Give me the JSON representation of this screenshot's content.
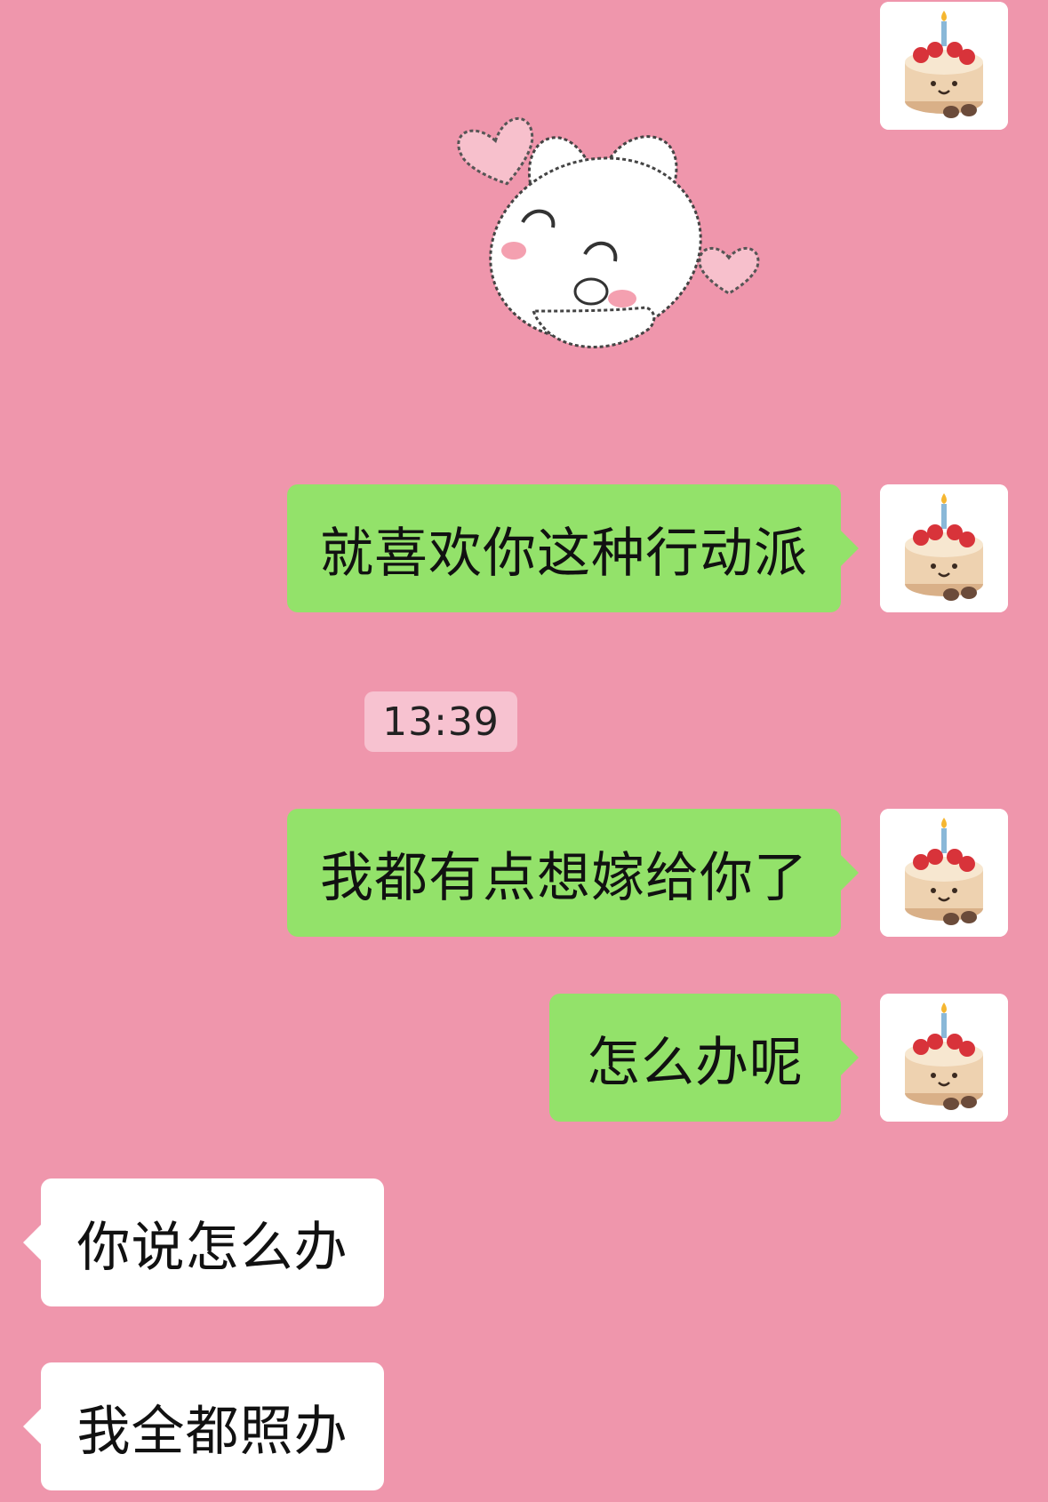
{
  "colors": {
    "background": "#ef96ac",
    "my_bubble": "#93e26a",
    "their_bubble": "#ffffff",
    "timestamp_bg": "#f7c2d0"
  },
  "stickers": [
    "bunny-with-hearts-sticker"
  ],
  "avatars": {
    "me": "birthday-cake-avatar"
  },
  "messages": [
    {
      "from": "me",
      "text": "就喜欢你这种行动派"
    },
    {
      "from": "me",
      "text": "我都有点想嫁给你了"
    },
    {
      "from": "me",
      "text": "怎么办呢"
    },
    {
      "from": "other",
      "text": "你说怎么办"
    },
    {
      "from": "other",
      "text": "我全都照办"
    }
  ],
  "timestamp": "13:39"
}
